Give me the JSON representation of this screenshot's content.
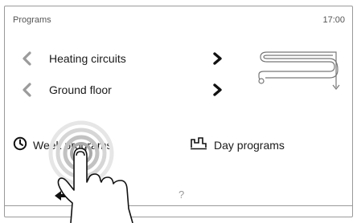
{
  "header": {
    "title": "Programs",
    "time": "17:00"
  },
  "selectors": [
    {
      "label": "Heating circuits"
    },
    {
      "label": "Ground floor"
    }
  ],
  "menu": {
    "week_programs": "Week programs",
    "day_programs": "Day programs"
  },
  "footer": {
    "help": "?"
  }
}
